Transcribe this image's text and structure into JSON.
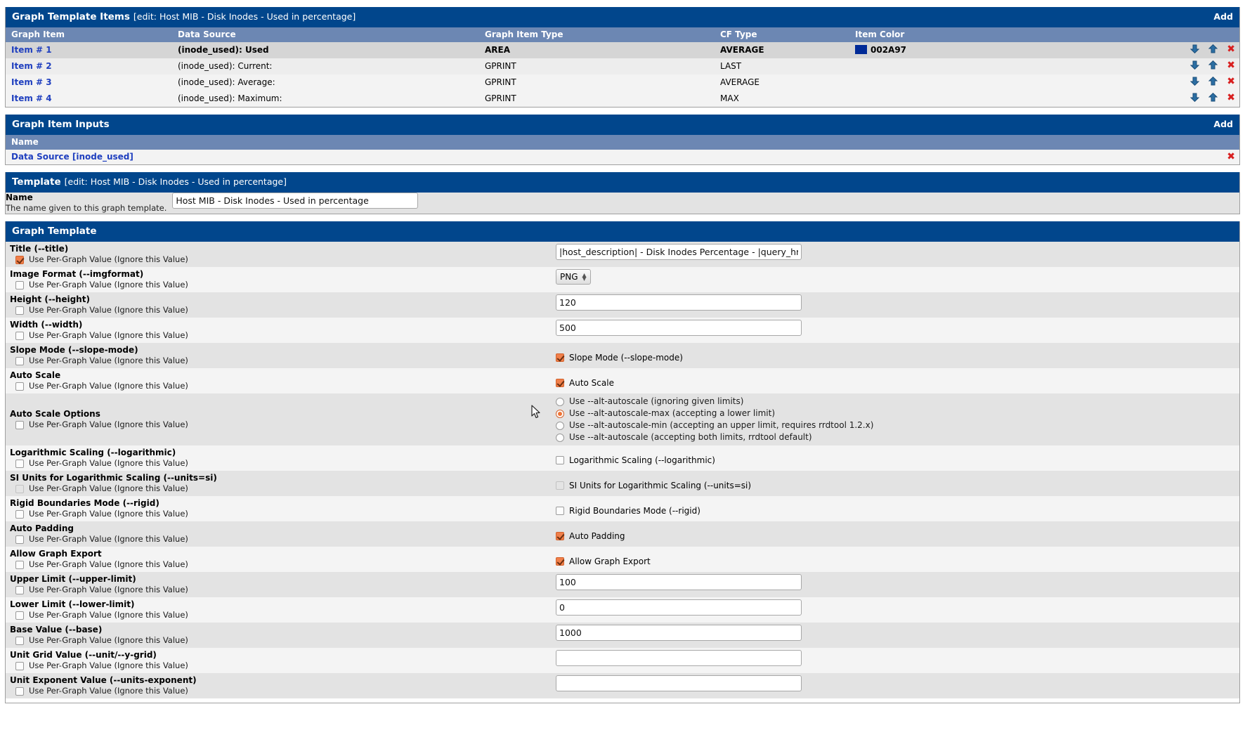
{
  "graph_template_items": {
    "title_main": "Graph Template Items",
    "title_sub": "[edit: Host MIB - Disk Inodes - Used in percentage]",
    "add_label": "Add",
    "columns": [
      "Graph Item",
      "Data Source",
      "Graph Item Type",
      "CF Type",
      "Item Color"
    ],
    "rows": [
      {
        "item": "Item # 1",
        "data_source": "(inode_used): Used",
        "graph_item_type": "AREA",
        "cf_type": "AVERAGE",
        "item_color": "002A97",
        "item_color_hex": "#002A97",
        "selected": true
      },
      {
        "item": "Item # 2",
        "data_source": "(inode_used): Current:",
        "graph_item_type": "GPRINT",
        "cf_type": "LAST",
        "item_color": "",
        "item_color_hex": "",
        "selected": false
      },
      {
        "item": "Item # 3",
        "data_source": "(inode_used): Average:",
        "graph_item_type": "GPRINT",
        "cf_type": "AVERAGE",
        "item_color": "",
        "item_color_hex": "",
        "selected": false
      },
      {
        "item": "Item # 4",
        "data_source": "(inode_used): Maximum:",
        "graph_item_type": "GPRINT",
        "cf_type": "MAX",
        "item_color": "",
        "item_color_hex": "",
        "selected": false
      }
    ]
  },
  "graph_item_inputs": {
    "title_main": "Graph Item Inputs",
    "add_label": "Add",
    "column": "Name",
    "rows": [
      {
        "name": "Data Source [inode_used]"
      }
    ]
  },
  "template": {
    "title_main": "Template",
    "title_sub": "[edit: Host MIB - Disk Inodes - Used in percentage]",
    "name_label": "Name",
    "name_desc": "The name given to this graph template.",
    "name_value": "Host MIB - Disk Inodes - Used in percentage"
  },
  "graph_template": {
    "title_main": "Graph Template",
    "per_graph_label": "Use Per-Graph Value (Ignore this Value)",
    "fields": [
      {
        "label": "Title (--title)",
        "per_graph_checked": true,
        "control": "text",
        "value": "|host_description| - Disk Inodes Percentage - |query_hrDis"
      },
      {
        "label": "Image Format (--imgformat)",
        "per_graph_checked": false,
        "control": "select",
        "value": "PNG"
      },
      {
        "label": "Height (--height)",
        "per_graph_checked": false,
        "control": "text",
        "value": "120"
      },
      {
        "label": "Width (--width)",
        "per_graph_checked": false,
        "control": "text",
        "value": "500"
      },
      {
        "label": "Slope Mode (--slope-mode)",
        "per_graph_checked": false,
        "control": "checkbox",
        "checkbox_label": "Slope Mode (--slope-mode)",
        "checked": true
      },
      {
        "label": "Auto Scale",
        "per_graph_checked": false,
        "control": "checkbox",
        "checkbox_label": "Auto Scale",
        "checked": true
      },
      {
        "label": "Auto Scale Options",
        "per_graph_checked": false,
        "control": "radio",
        "options": [
          {
            "label": "Use --alt-autoscale (ignoring given limits)",
            "selected": false
          },
          {
            "label": "Use --alt-autoscale-max (accepting a lower limit)",
            "selected": true
          },
          {
            "label": "Use --alt-autoscale-min (accepting an upper limit, requires rrdtool 1.2.x)",
            "selected": false
          },
          {
            "label": "Use --alt-autoscale (accepting both limits, rrdtool default)",
            "selected": false
          }
        ]
      },
      {
        "label": "Logarithmic Scaling (--logarithmic)",
        "per_graph_checked": false,
        "control": "checkbox",
        "checkbox_label": "Logarithmic Scaling (--logarithmic)",
        "checked": false
      },
      {
        "label": "SI Units for Logarithmic Scaling (--units=si)",
        "per_graph_checked": false,
        "per_graph_disabled": true,
        "control": "checkbox",
        "checkbox_label": "SI Units for Logarithmic Scaling (--units=si)",
        "checked": false,
        "disabled": true
      },
      {
        "label": "Rigid Boundaries Mode (--rigid)",
        "per_graph_checked": false,
        "control": "checkbox",
        "checkbox_label": "Rigid Boundaries Mode (--rigid)",
        "checked": false
      },
      {
        "label": "Auto Padding",
        "per_graph_checked": false,
        "control": "checkbox",
        "checkbox_label": "Auto Padding",
        "checked": true
      },
      {
        "label": "Allow Graph Export",
        "per_graph_checked": false,
        "control": "checkbox",
        "checkbox_label": "Allow Graph Export",
        "checked": true
      },
      {
        "label": "Upper Limit (--upper-limit)",
        "per_graph_checked": false,
        "control": "text",
        "value": "100"
      },
      {
        "label": "Lower Limit (--lower-limit)",
        "per_graph_checked": false,
        "control": "text",
        "value": "0"
      },
      {
        "label": "Base Value (--base)",
        "per_graph_checked": false,
        "control": "text",
        "value": "1000"
      },
      {
        "label": "Unit Grid Value (--unit/--y-grid)",
        "per_graph_checked": false,
        "control": "text",
        "value": ""
      },
      {
        "label": "Unit Exponent Value (--units-exponent)",
        "per_graph_checked": false,
        "control": "text",
        "value": ""
      }
    ]
  },
  "colors": {
    "header_blue": "#01468C",
    "subheader_blue": "#6C87B3",
    "link_blue": "#1F3FBF",
    "accent_orange": "#F07F4A",
    "delete_red": "#D81F1F"
  }
}
